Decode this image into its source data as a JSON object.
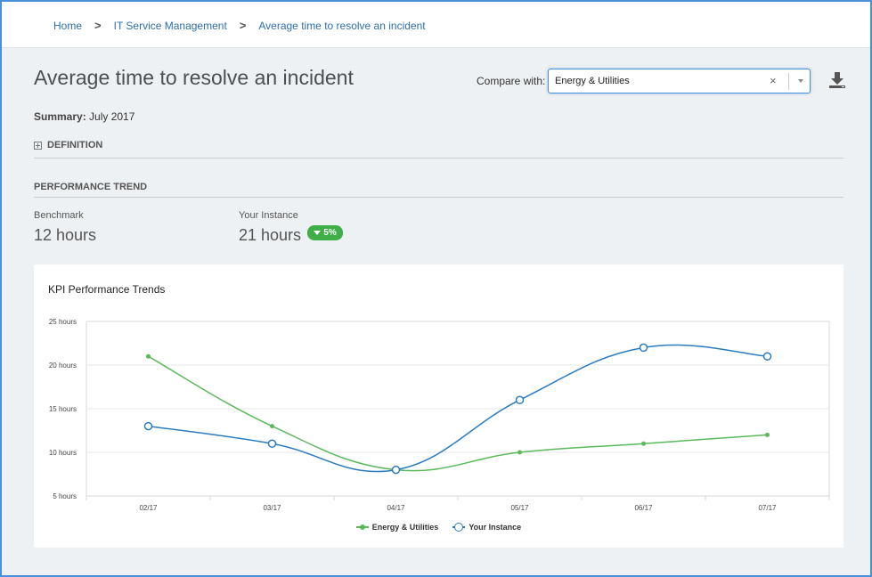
{
  "breadcrumb": {
    "items": [
      "Home",
      "IT Service Management",
      "Average time to resolve an incident"
    ],
    "separator": ">"
  },
  "page": {
    "title": "Average time to resolve an incident",
    "compare_label": "Compare with:",
    "compare_value": "Energy & Utilities",
    "summary_label": "Summary:",
    "summary_value": "July 2017",
    "definition_label": "DEFINITION",
    "performance_trend_label": "PERFORMANCE TREND"
  },
  "metrics": {
    "benchmark_label": "Benchmark",
    "benchmark_value": "12 hours",
    "instance_label": "Your Instance",
    "instance_value": "21 hours",
    "badge_text": "5%"
  },
  "colors": {
    "accent": "#2f6fae",
    "green": "#5cb85c",
    "blue": "#2b7bbf",
    "badge_green": "#3fae47"
  },
  "icons": {
    "download": "download-icon",
    "expand": "plus-box-icon",
    "clear": "clear-icon",
    "dropdown": "chevron-down-icon"
  },
  "chart_data": {
    "type": "line",
    "title": "KPI Performance Trends",
    "categories": [
      "02/17",
      "03/17",
      "04/17",
      "05/17",
      "06/17",
      "07/17"
    ],
    "y_ticks": [
      "25 hours",
      "20 hours",
      "15 hours",
      "10 hours",
      "5 hours"
    ],
    "ylim": [
      5,
      25
    ],
    "series": [
      {
        "name": "Energy & Utilities",
        "values": [
          21,
          13,
          8,
          10,
          11,
          12
        ],
        "color": "#5cb85c",
        "marker": "dot"
      },
      {
        "name": "Your Instance",
        "values": [
          13,
          11,
          8,
          16,
          22,
          21
        ],
        "color": "#2b7bbf",
        "marker": "ring"
      }
    ],
    "grid": true,
    "legend_position": "bottom"
  }
}
